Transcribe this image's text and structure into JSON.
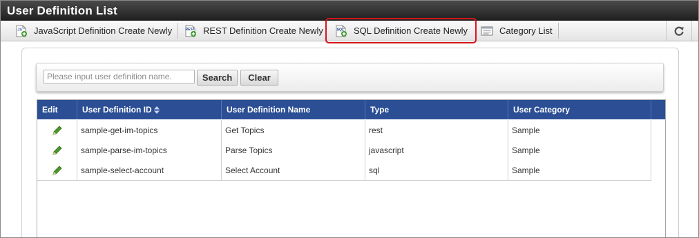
{
  "window": {
    "title": "User Definition List"
  },
  "toolbar": {
    "buttons": [
      {
        "label": "JavaScript Definition Create Newly",
        "icon": "javascript-file-add-icon"
      },
      {
        "label": "REST Definition Create Newly",
        "icon": "rest-file-add-icon"
      },
      {
        "label": "SQL Definition Create Newly",
        "icon": "sql-file-add-icon"
      },
      {
        "label": "Category List",
        "icon": "list-window-icon"
      }
    ],
    "refresh_icon": "refresh-icon",
    "highlight_color": "#d8161b"
  },
  "search": {
    "placeholder": "Please input user definition name.",
    "value": "",
    "search_label": "Search",
    "clear_label": "Clear"
  },
  "table": {
    "header_color": "#2b4e95",
    "columns": [
      "Edit",
      "User Definition ID",
      "User Definition Name",
      "Type",
      "User Category"
    ],
    "sorted_column": "User Definition ID",
    "rows": [
      {
        "id": "sample-get-im-topics",
        "name": "Get Topics",
        "type": "rest",
        "category": "Sample"
      },
      {
        "id": "sample-parse-im-topics",
        "name": "Parse Topics",
        "type": "javascript",
        "category": "Sample"
      },
      {
        "id": "sample-select-account",
        "name": "Select Account",
        "type": "sql",
        "category": "Sample"
      }
    ],
    "edit_icon": "pencil-icon"
  }
}
